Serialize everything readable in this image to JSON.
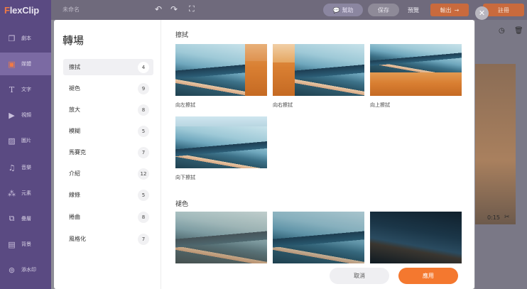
{
  "app": {
    "logo_prefix": "F",
    "logo_rest": "lexClip"
  },
  "topbar": {
    "project_name": "未命名",
    "help_label": "幫助",
    "save_label": "保存",
    "preview_label": "預覽",
    "export_label": "輸出",
    "signup_label": "註冊"
  },
  "sidebar": {
    "items": [
      {
        "label": "劇本",
        "icon": "layers-icon"
      },
      {
        "label": "媒體",
        "icon": "folder-icon"
      },
      {
        "label": "文字",
        "icon": "text-icon"
      },
      {
        "label": "視頻",
        "icon": "video-icon"
      },
      {
        "label": "圖片",
        "icon": "image-icon"
      },
      {
        "label": "音樂",
        "icon": "music-icon"
      },
      {
        "label": "元素",
        "icon": "elements-icon"
      },
      {
        "label": "疊層",
        "icon": "overlay-icon"
      },
      {
        "label": "背景",
        "icon": "background-icon"
      },
      {
        "label": "添水印",
        "icon": "watermark-icon"
      }
    ],
    "active_index": 1
  },
  "modal": {
    "title": "轉場",
    "categories": [
      {
        "label": "擦拭",
        "count": "4"
      },
      {
        "label": "褪色",
        "count": "9"
      },
      {
        "label": "放大",
        "count": "8"
      },
      {
        "label": "模糊",
        "count": "5"
      },
      {
        "label": "馬賽克",
        "count": "7"
      },
      {
        "label": "介紹",
        "count": "12"
      },
      {
        "label": "線條",
        "count": "5"
      },
      {
        "label": "捲曲",
        "count": "8"
      },
      {
        "label": "風格化",
        "count": "7"
      }
    ],
    "active_category": 0,
    "sections": [
      {
        "title": "擦拭",
        "items": [
          "向左擦拭",
          "向右擦拭",
          "向上擦拭",
          "向下擦拭"
        ]
      },
      {
        "title": "褪色",
        "items": [
          "",
          "",
          ""
        ]
      }
    ],
    "cancel_label": "取消",
    "apply_label": "應用"
  },
  "timeline": {
    "duration": "0:15"
  },
  "colors": {
    "accent": "#f4782f",
    "sidebar": "#5a4a82"
  }
}
